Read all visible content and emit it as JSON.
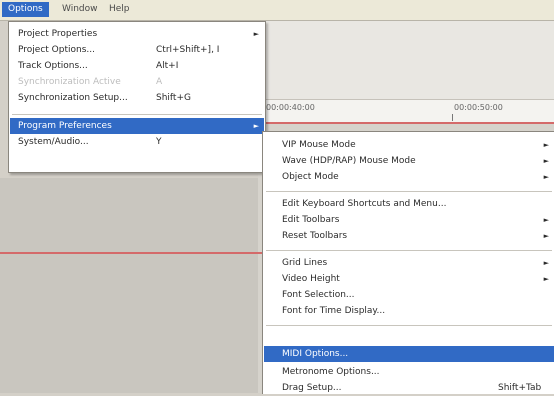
{
  "menubar": {
    "options": "Options",
    "window": "Window",
    "help": "Help"
  },
  "timeline": {
    "tick1": "00:00:40:00",
    "tick2": "00:00:50:00"
  },
  "options_menu": {
    "items": [
      {
        "label": "Project Properties",
        "shortcut": "",
        "has_submenu": true
      },
      {
        "label": "Project Options...",
        "shortcut": "Ctrl+Shift+], I",
        "has_submenu": false
      },
      {
        "label": "Track Options...",
        "shortcut": "Alt+I",
        "has_submenu": false
      },
      {
        "label": "Synchronization Active",
        "shortcut": "A",
        "has_submenu": false,
        "disabled": true
      },
      {
        "label": "Synchronization Setup...",
        "shortcut": "Shift+G",
        "has_submenu": false
      },
      {
        "label": "Program Preferences",
        "shortcut": "",
        "has_submenu": true,
        "selected": true
      },
      {
        "label": "System/Audio...",
        "shortcut": "Y",
        "has_submenu": false
      }
    ],
    "arrow": "►"
  },
  "prefs_menu": {
    "items": [
      {
        "label": "VIP Mouse Mode",
        "has_submenu": true
      },
      {
        "label": "Wave (HDP/RAP) Mouse Mode",
        "has_submenu": true
      },
      {
        "label": "Object Mode",
        "has_submenu": true
      },
      {
        "label": "Edit Keyboard Shortcuts and Menu...",
        "has_submenu": false
      },
      {
        "label": "Edit Toolbars",
        "has_submenu": true
      },
      {
        "label": "Reset Toolbars",
        "has_submenu": true
      },
      {
        "label": "Grid Lines",
        "has_submenu": true
      },
      {
        "label": "Video Height",
        "has_submenu": true
      },
      {
        "label": "Font Selection...",
        "has_submenu": false
      },
      {
        "label": "Font for Time Display...",
        "has_submenu": false
      },
      {
        "label": "MIDI Options...",
        "has_submenu": false,
        "selected": true
      },
      {
        "label": "Metronome Options...",
        "has_submenu": false
      },
      {
        "label": "Drag Setup...",
        "has_submenu": false,
        "shortcut": "Shift+Tab"
      }
    ],
    "arrow": "►"
  },
  "colors": {
    "selection": "#316ac5",
    "menubar": "#ece9d8",
    "timeline_line": "#d46a6a"
  }
}
